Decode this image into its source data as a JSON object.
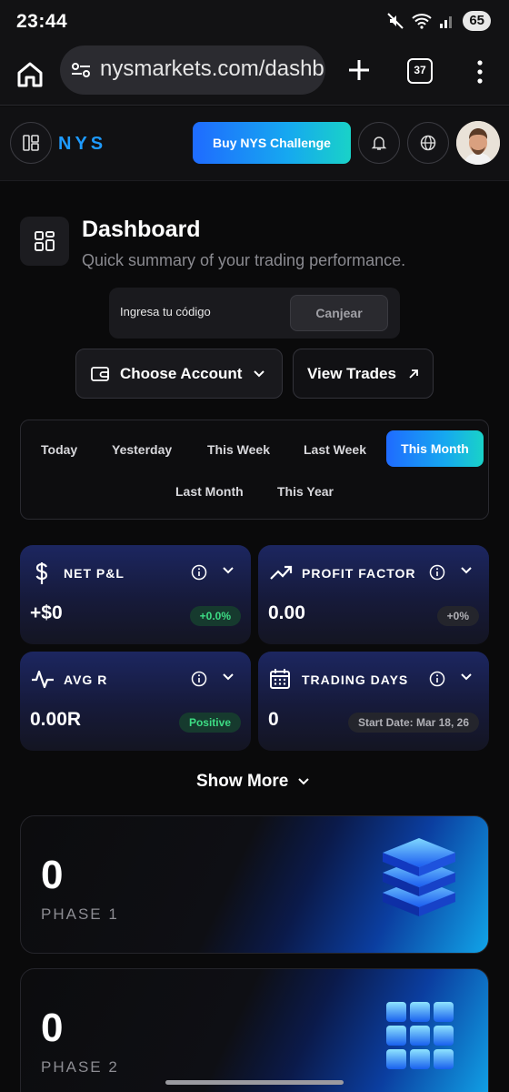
{
  "status_bar": {
    "time": "23:44",
    "battery": "65"
  },
  "browser": {
    "url": "nysmarkets.com/dashb",
    "tab_count": "37"
  },
  "header": {
    "logo": "NYS",
    "buy_button": "Buy NYS Challenge"
  },
  "dashboard": {
    "title": "Dashboard",
    "subtitle": "Quick summary of your trading performance.",
    "code_placeholder": "Ingresa tu código",
    "redeem_button": "Canjear",
    "choose_account": "Choose Account",
    "view_trades": "View Trades"
  },
  "periods": {
    "items": [
      "Today",
      "Yesterday",
      "This Week",
      "Last Week",
      "This Month",
      "Last Month",
      "This Year"
    ],
    "active": "This Month"
  },
  "stats": [
    {
      "label": "NET P&L",
      "value": "+$0",
      "badge": "+0.0%",
      "icon": "dollar-icon"
    },
    {
      "label": "PROFIT FACTOR",
      "value": "0.00",
      "badge": "+0%",
      "icon": "trending-up-icon"
    },
    {
      "label": "AVG R",
      "value": "0.00R",
      "badge": "Positive",
      "icon": "pulse-icon"
    },
    {
      "label": "TRADING DAYS",
      "value": "0",
      "badge": "Start Date: Mar 18, 26",
      "icon": "calendar-icon"
    }
  ],
  "show_more": "Show More",
  "phases": [
    {
      "count": "0",
      "label": "PHASE 1"
    },
    {
      "count": "0",
      "label": "PHASE 2"
    }
  ],
  "colors": {
    "accent_start": "#1f6bff",
    "accent_end": "#19d2c8",
    "positive": "#3ddc84"
  }
}
